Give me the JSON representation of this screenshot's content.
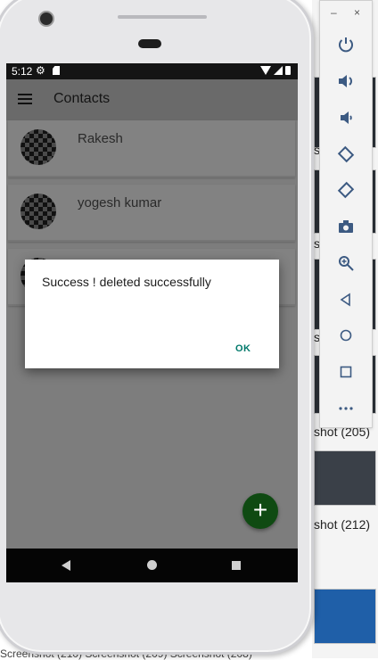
{
  "app": {
    "status_time": "5:12",
    "title": "Contacts",
    "contacts": [
      {
        "name": "Rakesh"
      },
      {
        "name": "yogesh kumar"
      },
      {
        "name": ""
      }
    ],
    "dialog": {
      "message": "Success ! deleted successfully",
      "ok_label": "OK"
    },
    "fab_symbol": "+"
  },
  "emulator_toolbar": {
    "minimize": "–",
    "close": "×",
    "icons": [
      "power-icon",
      "volume-up-icon",
      "volume-down-icon",
      "rotate-left-icon",
      "rotate-right-icon",
      "camera-icon",
      "zoom-icon",
      "back-icon",
      "home-icon",
      "overview-icon",
      "more-icon"
    ]
  },
  "desktop": {
    "captions": [
      "shot (205)",
      "shot (212)"
    ],
    "partial_s": "s",
    "bottom_caption": "Screenshot (210)   Screenshot (209)   Screenshot (208)"
  },
  "colors": {
    "appbar": "#6a6a6a",
    "fab": "#0f4a12",
    "dialog_button": "#00796b",
    "toolbar_icon": "#3c5a82"
  }
}
